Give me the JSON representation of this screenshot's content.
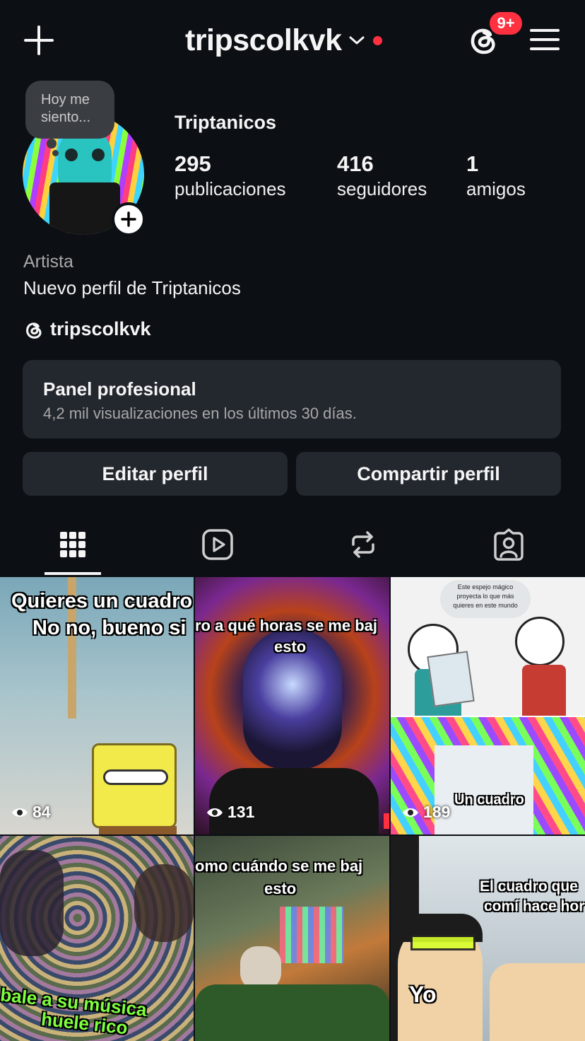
{
  "header": {
    "username": "tripscolkvk",
    "notification_badge": "9+"
  },
  "profile": {
    "note_bubble": "Hoy me siento...",
    "display_name": "Triptanicos",
    "stats": [
      {
        "value": "295",
        "label": "publicaciones"
      },
      {
        "value": "416",
        "label": "seguidores"
      },
      {
        "value": "1",
        "label": "amigos"
      }
    ],
    "category": "Artista",
    "bio": "Nuevo perfil de Triptanicos",
    "threads_handle": "tripscolkvk"
  },
  "panel": {
    "title": "Panel profesional",
    "subtitle": "4,2 mil visualizaciones en los últimos 30 días."
  },
  "buttons": {
    "edit": "Editar perfil",
    "share": "Compartir perfil"
  },
  "tabs": [
    {
      "icon": "grid-icon",
      "active": true
    },
    {
      "icon": "reels-icon",
      "active": false
    },
    {
      "icon": "reposts-icon",
      "active": false
    },
    {
      "icon": "tagged-icon",
      "active": false
    }
  ],
  "grid": [
    {
      "caption1": "Quieres un cuadro",
      "caption2": "No no, bueno si",
      "views": "84"
    },
    {
      "caption1": "ro a qué horas se me baj",
      "caption2": "esto",
      "views": "131"
    },
    {
      "caption_top": "Este espejo mágico proyecta lo que más quieres en este mundo",
      "caption1": "Un cuadro",
      "views": "189"
    },
    {
      "caption1": "bale a su música",
      "caption2": "huele rico"
    },
    {
      "caption1": "omo cuándo se me baj",
      "caption2": "esto"
    },
    {
      "caption1": "El cuadro que ",
      "caption2": "comí hace hor",
      "caption3": "Yo"
    }
  ],
  "colors": {
    "background": "#0c0f14",
    "card": "#23272e",
    "accent_red": "#ff3040"
  }
}
